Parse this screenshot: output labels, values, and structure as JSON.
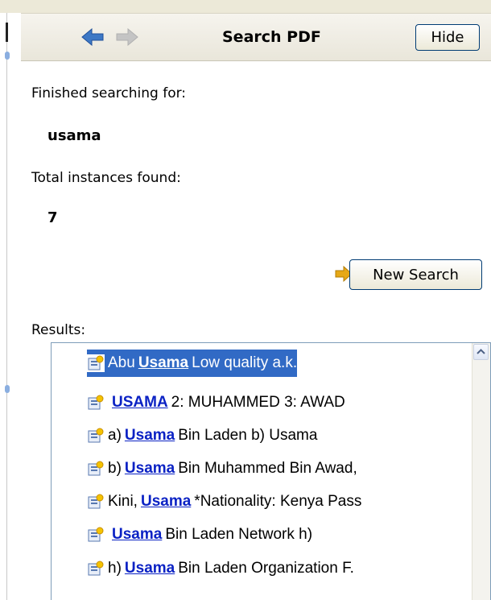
{
  "toolbar": {
    "title": "Search PDF",
    "hide_label": "Hide",
    "back_icon": "arrow-left-icon",
    "forward_icon": "arrow-right-icon"
  },
  "search": {
    "finished_label": "Finished searching for:",
    "query": "usama",
    "total_label": "Total instances found:",
    "count": "7",
    "new_search_label": "New Search"
  },
  "results": {
    "label": "Results:",
    "items": [
      {
        "pre": "Abu",
        "hit": "Usama",
        "post": "Low quality a.k.",
        "selected": true
      },
      {
        "pre": "",
        "hit": "USAMA",
        "post": "2: MUHAMMED 3: AWAD",
        "selected": false
      },
      {
        "pre": "a)",
        "hit": "Usama",
        "post": "Bin Laden b) Usama",
        "selected": false
      },
      {
        "pre": "b)",
        "hit": "Usama",
        "post": "Bin Muhammed Bin Awad,",
        "selected": false
      },
      {
        "pre": "Kini,",
        "hit": "Usama",
        "post": "*Nationality: Kenya Pass",
        "selected": false
      },
      {
        "pre": "",
        "hit": "Usama",
        "post": "Bin Laden Network h)",
        "selected": false
      },
      {
        "pre": "h)",
        "hit": "Usama",
        "post": "Bin Laden Organization F.",
        "selected": false
      }
    ]
  },
  "colors": {
    "selection": "#316ac5",
    "hit_link": "#0b22c4",
    "toolbar_bg": "#ece9d8",
    "nav_arrow_active": "#3d78c5",
    "nav_arrow_disabled": "#c4c4c4",
    "new_search_arrow": "#e6a817"
  }
}
